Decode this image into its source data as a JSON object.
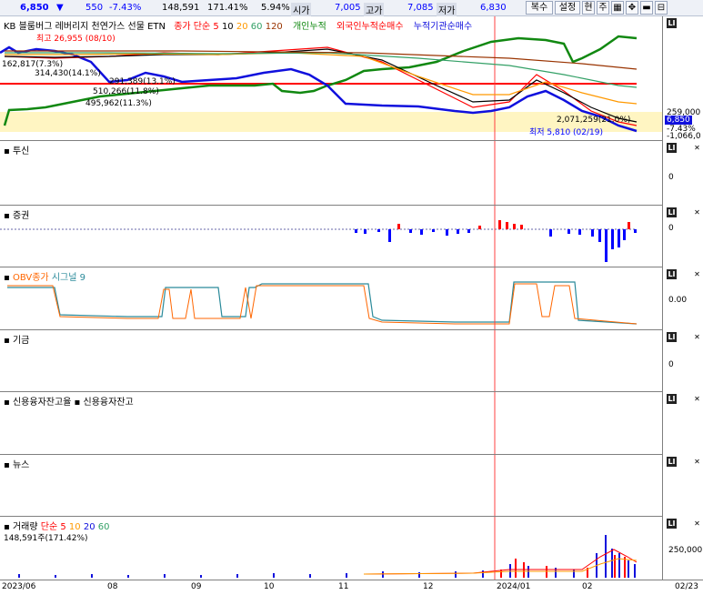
{
  "header": {
    "price": "6,850",
    "change_arrow": "▼",
    "change": "550",
    "change_rate": "-7.43%",
    "volume": "148,591",
    "volume_rate": "171.41%",
    "turnover": "5.94%",
    "open_label": "시가",
    "open": "7,005",
    "high_label": "고가",
    "high": "7,085",
    "low_label": "저가",
    "low": "6,830",
    "btn_copy": "복수",
    "btn_settings": "설정",
    "btn_current": "현",
    "btn_week": "주",
    "colors": {
      "down": "#0000ff",
      "up": "#ff0000"
    }
  },
  "price_panel": {
    "title": "KB 블룸버그 레버리지 천연가스 선물 ETN",
    "ma_label": "종가 단순 5",
    "ma_periods": [
      "10",
      "20",
      "60",
      "120"
    ],
    "legend_retail": "개인누적",
    "legend_foreign": "외국인누적순매수",
    "legend_inst": "누적기관순매수",
    "high_text": "최고 26,955 (08/10)",
    "low_text": "최저 5,810 (02/19)",
    "label_a": "162,817(7.3%)",
    "label_b": "314,430(14.1%)",
    "label_c": "291,389(13.1%)",
    "label_d": "510,266(11.8%)",
    "label_e": "495,962(11.3%)",
    "label_f": "2,071,259(21.0%)",
    "axis_y1": "259,000",
    "axis_price": "6,850",
    "axis_rate": "-7.43%",
    "axis_y2": "-1,066,0"
  },
  "panels": [
    {
      "title": "투신",
      "axis": "0"
    },
    {
      "title": "증권",
      "axis": "0"
    },
    {
      "title": "OBV종가",
      "extra": "시그널 9",
      "axis": "0.00"
    },
    {
      "title": "기금",
      "axis": "0"
    },
    {
      "title": "신용융자잔고율",
      "extra": "신용융자잔고",
      "axis": ""
    },
    {
      "title": "뉴스",
      "axis": ""
    }
  ],
  "volume_panel": {
    "title": "거래량",
    "ma_label": "단순 5",
    "periods": [
      "10",
      "20",
      "60"
    ],
    "value_text": "148,591주(171.42%)",
    "axis": "250,000"
  },
  "xaxis": {
    "labels": [
      "2023/06",
      "08",
      "09",
      "10",
      "11",
      "12",
      "2024/01",
      "02"
    ],
    "date": "02/23"
  }
}
